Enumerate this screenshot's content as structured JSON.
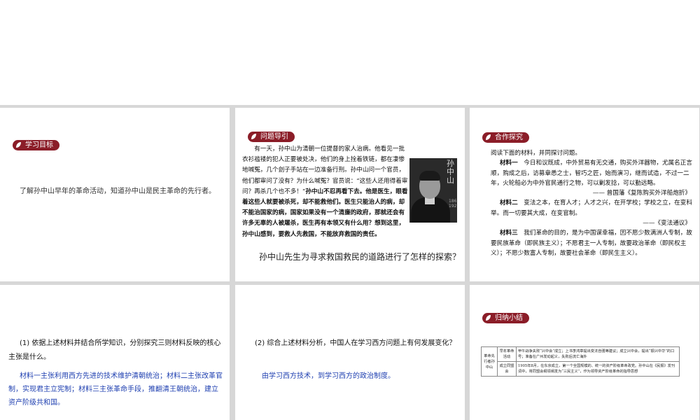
{
  "slide1": {
    "tag": "学习目标",
    "goal": "了解孙中山早年的革命活动，知道孙中山是民主革命的先行者。"
  },
  "slide2": {
    "tag": "问题导引",
    "story_plain": "有一天，孙中山为清朝一位提督的家人治病。他看见一批衣衫褴褛的犯人正要被处决，他们的身上拴着铁链，都在凄惨地喊冤，几个刽子手站在一边准备行刑。孙中山问一个官员，他们都审问了没有？为什么喊冤？官员说：“这些人还用得着审问？再杀几个也不多！”",
    "story_bold": "孙中山不忍再看下去。他是医生，眼看着这些人就要被杀死，却不能救他们。医生只能治人的病，却不能治国家的病，国家如果没有一个清廉的政府，那就还会有许多无辜的人被屠杀，医生再有本领又有什么用？想到这里，孙中山感到，要救人先救国，不能放弃救国的责任。",
    "portrait_title": "孙中山",
    "portrait_sub": "1866-1925",
    "question": "孙中山先生为寻求救国救民的道路进行了怎样的探索？"
  },
  "slide3": {
    "tag": "合作探究",
    "intro": "阅读下面的材料，并同探讨问题。",
    "m1_head": "材料一",
    "m1_text": "今日和议既成，中外贸易有无交通，购买外洋器物，尤属名正言顺，购成之后，访募章悉之士，智巧之匠，始而演习，继而试造，不过一二年，火轮船必为中外官民通行之物，可以剿发捻，可以勤远略。",
    "m1_src": "—— 曾国藩《复陈购买外洋船炮折》",
    "m2_head": "材料二",
    "m2_text": "变法之本，在育人才；人才之兴，在开学校；学校之立，在变科举。而一切要其大成，在变官制。",
    "m2_src": "——《变法通议》",
    "m3_head": "材料三",
    "m3_text": "我们革命的目的，是为中国谋幸福，因不愿少数满洲人专制，故要民族革命（即民族主义）；不愿君主一人专制，故要政治革命（即民权主义）；不愿少数富人专制，故要社会革命（即民生主义）。"
  },
  "slide4": {
    "question": "(1) 依据上述材料并结合所学知识，分别探究三则材料反映的核心主张是什么。",
    "answer": "材料一主张利用西方先进的技术维护清朝统治；材料二主张改革官制，实现君主立宪制；材料三主张革命手段，推翻清王朝统治，建立资产阶级共和国。"
  },
  "slide5": {
    "question": "(2) 综合上述材料分析，中国人在学习西方问题上有何发展变化？",
    "answer": "由学习西方技术，到学习西方的政治制度。"
  },
  "slide6": {
    "tag": "归纳小结",
    "table_head": "革命先行者孙中山",
    "rows": [
      {
        "label": "早年革命活动",
        "content": "甲午战争失败“兴中会”成立；上书李鸿章提出变法自强等建议；成立兴中会，提出“振兴中华”的口号；准备在广州发动起义，失败后流亡海外"
      },
      {
        "label": "成立同盟会",
        "content": "1905年8月，在东京成立，第一个全国规模的、统一的资产阶级革命政党。孙中山在《民报》发刊词中，将同盟会纲领阐发为“三民主义”，作为领导资产阶级革命的指导思想"
      }
    ]
  }
}
